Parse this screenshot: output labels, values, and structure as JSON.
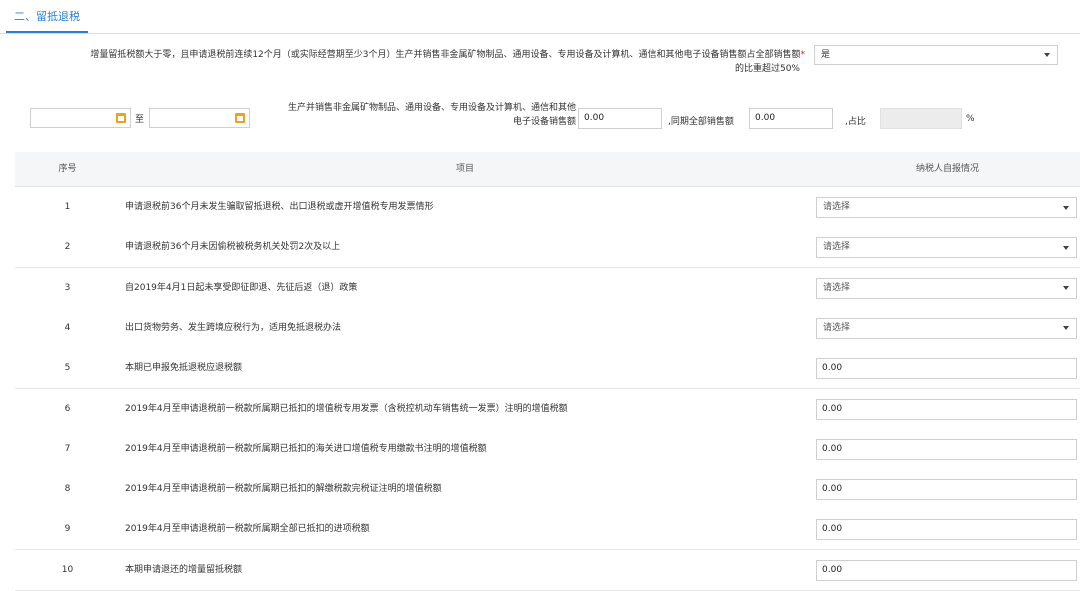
{
  "section": {
    "tab_label": "二、留抵退税"
  },
  "question": {
    "text_line1": "增量留抵税额大于零，且申请退税前连续12个月（或实际经营期至少3个月）生产并销售非金属矿物制品、通用设备、专用设备及计算机、通信和其他电子设备销售额占全部销售额",
    "text_line2": "的比重超过50%",
    "required_mark": "*",
    "answer": "是"
  },
  "sales": {
    "to_label": "至",
    "date_from": "",
    "date_to": "",
    "label_line1": "生产并销售非金属矿物制品、通用设备、专用设备及计算机、通信和其他",
    "label_line2": "电子设备销售额",
    "amount": "0.00",
    "total_label": ",同期全部销售额",
    "total_amount": "0.00",
    "ratio_label": ",占比",
    "ratio_value": "",
    "percent": "%"
  },
  "table": {
    "headers": {
      "seq": "序号",
      "item": "项目",
      "declare": "纳税人自报情况"
    },
    "rows": [
      {
        "seq": "1",
        "item": "申请退税前36个月未发生骗取留抵退税、出口退税或虚开增值税专用发票情形",
        "value": "请选择"
      },
      {
        "seq": "2",
        "item": "申请退税前36个月未因偷税被税务机关处罚2次及以上",
        "value": "请选择"
      },
      {
        "seq": "3",
        "item": "自2019年4月1日起未享受即征即退、先征后返（退）政策",
        "value": "请选择"
      },
      {
        "seq": "4",
        "item": "出口货物劳务、发生跨境应税行为，适用免抵退税办法",
        "value": "请选择"
      },
      {
        "seq": "5",
        "item": "本期已申报免抵退税应退税额",
        "value": "0.00"
      },
      {
        "seq": "6",
        "item": "2019年4月至申请退税前一税款所属期已抵扣的增值税专用发票（含税控机动车销售统一发票）注明的增值税额",
        "value": "0.00"
      },
      {
        "seq": "7",
        "item": "2019年4月至申请退税前一税款所属期已抵扣的海关进口增值税专用缴款书注明的增值税额",
        "value": "0.00"
      },
      {
        "seq": "8",
        "item": "2019年4月至申请退税前一税款所属期已抵扣的解缴税款完税证注明的增值税额",
        "value": "0.00"
      },
      {
        "seq": "9",
        "item": "2019年4月至申请退税前一税款所属期全部已抵扣的进项税额",
        "value": "0.00"
      },
      {
        "seq": "10",
        "item": "本期申请退还的增量留抵税额",
        "value": "0.00"
      }
    ]
  }
}
